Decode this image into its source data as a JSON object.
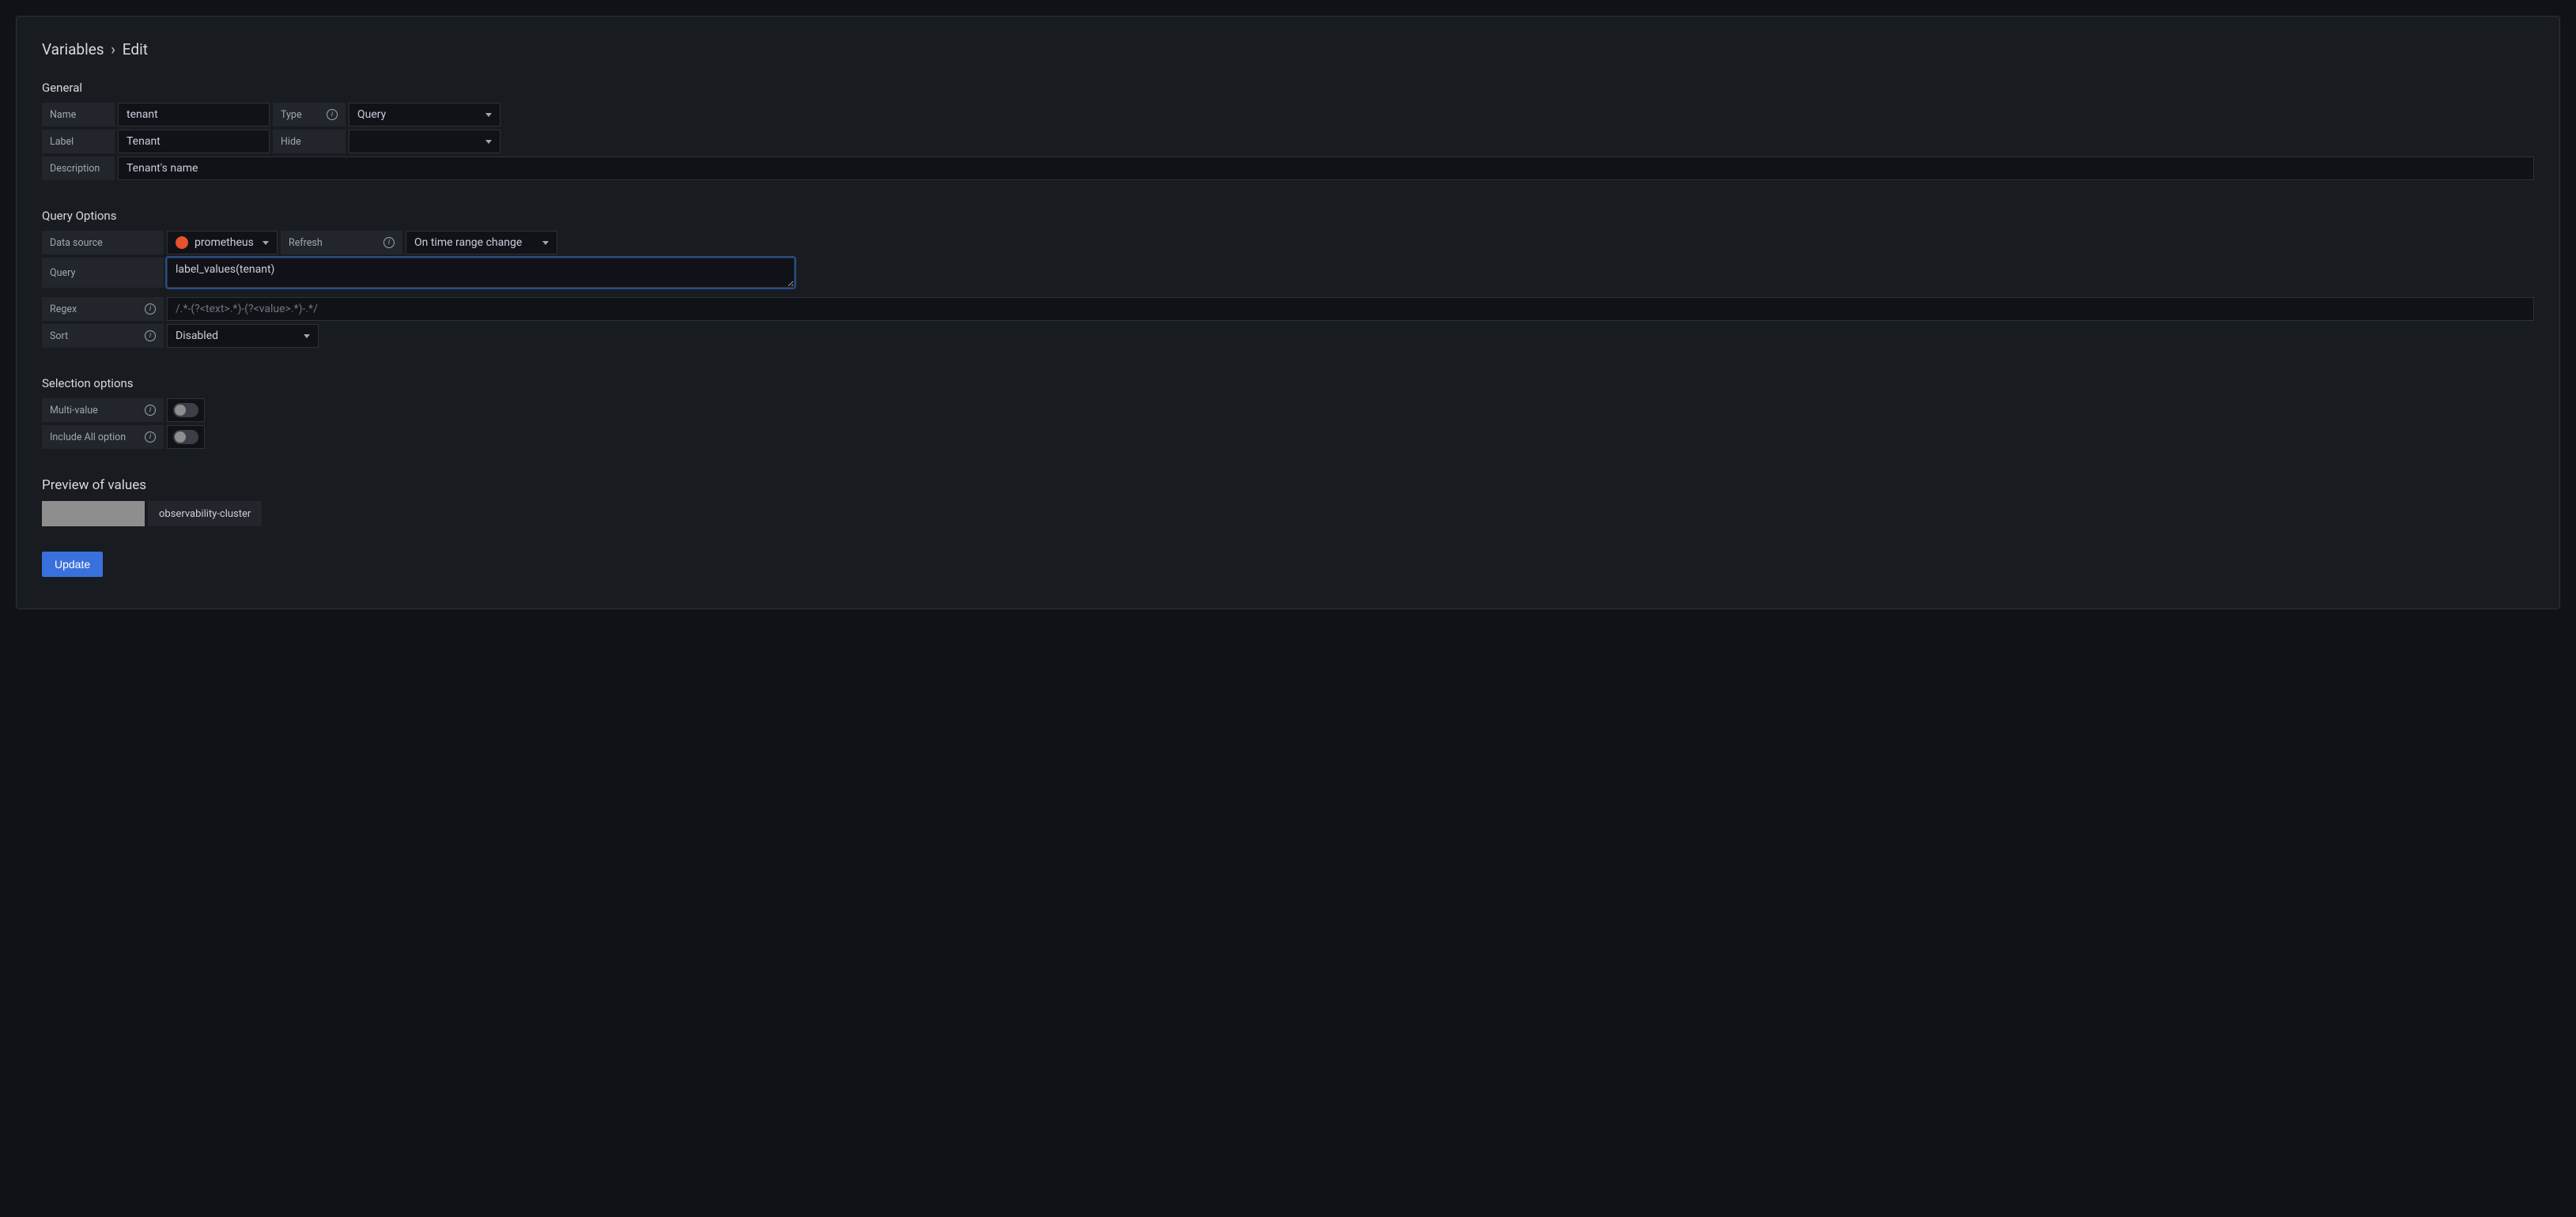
{
  "breadcrumb": {
    "root": "Variables",
    "sep": "›",
    "current": "Edit"
  },
  "general": {
    "title": "General",
    "name_label": "Name",
    "name_value": "tenant",
    "type_label": "Type",
    "type_value": "Query",
    "label_label": "Label",
    "label_value": "Tenant",
    "hide_label": "Hide",
    "hide_value": "",
    "description_label": "Description",
    "description_value": "Tenant's name"
  },
  "query_options": {
    "title": "Query Options",
    "datasource_label": "Data source",
    "datasource_value": "prometheus",
    "refresh_label": "Refresh",
    "refresh_value": "On time range change",
    "query_label": "Query",
    "query_value": "label_values(tenant)",
    "regex_label": "Regex",
    "regex_placeholder": "/.*-(?<text>.*)-(?<value>.*)-.*/",
    "sort_label": "Sort",
    "sort_value": "Disabled"
  },
  "selection": {
    "title": "Selection options",
    "multi_label": "Multi-value",
    "multi_on": false,
    "all_label": "Include All option",
    "all_on": false
  },
  "preview": {
    "title": "Preview of values",
    "values": [
      "",
      "observability-cluster"
    ]
  },
  "actions": {
    "update": "Update"
  },
  "icons": {
    "info": "i"
  }
}
